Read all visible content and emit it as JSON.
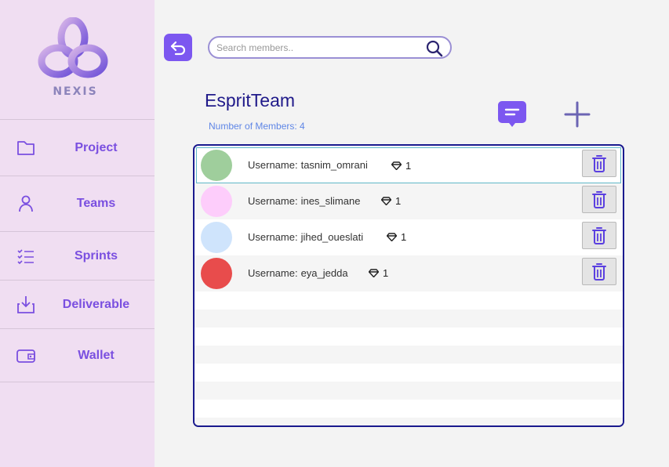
{
  "brand": {
    "name": "NEXIS"
  },
  "sidebar": {
    "items": [
      {
        "label": "Project",
        "icon": "folder-icon"
      },
      {
        "label": "Teams",
        "icon": "user-icon"
      },
      {
        "label": "Sprints",
        "icon": "checklist-icon"
      },
      {
        "label": "Deliverable",
        "icon": "download-icon"
      },
      {
        "label": "Wallet",
        "icon": "wallet-icon"
      }
    ]
  },
  "search": {
    "placeholder": "Search members..",
    "value": ""
  },
  "team": {
    "name": "EspritTeam",
    "members_count_label": "Number of Members: 4"
  },
  "members": [
    {
      "username_label": "Username:",
      "username": "tasnim_omrani",
      "gems": "1",
      "avatar_color": "#9fce9c",
      "selected": true
    },
    {
      "username_label": "Username:",
      "username": "ines_slimane",
      "gems": "1",
      "avatar_color": "#fdcdfb",
      "selected": false
    },
    {
      "username_label": "Username:",
      "username": "jihed_oueslati",
      "gems": "1",
      "avatar_color": "#cfe4fc",
      "selected": false
    },
    {
      "username_label": "Username:",
      "username": "eya_jedda",
      "gems": "1",
      "avatar_color": "#e84c4c",
      "selected": false
    }
  ],
  "colors": {
    "accent": "#7c57f0",
    "title": "#201a8a",
    "count": "#5f86e6",
    "sidebar_bg": "#f0def2",
    "panel_border": "#1a1a8e"
  }
}
